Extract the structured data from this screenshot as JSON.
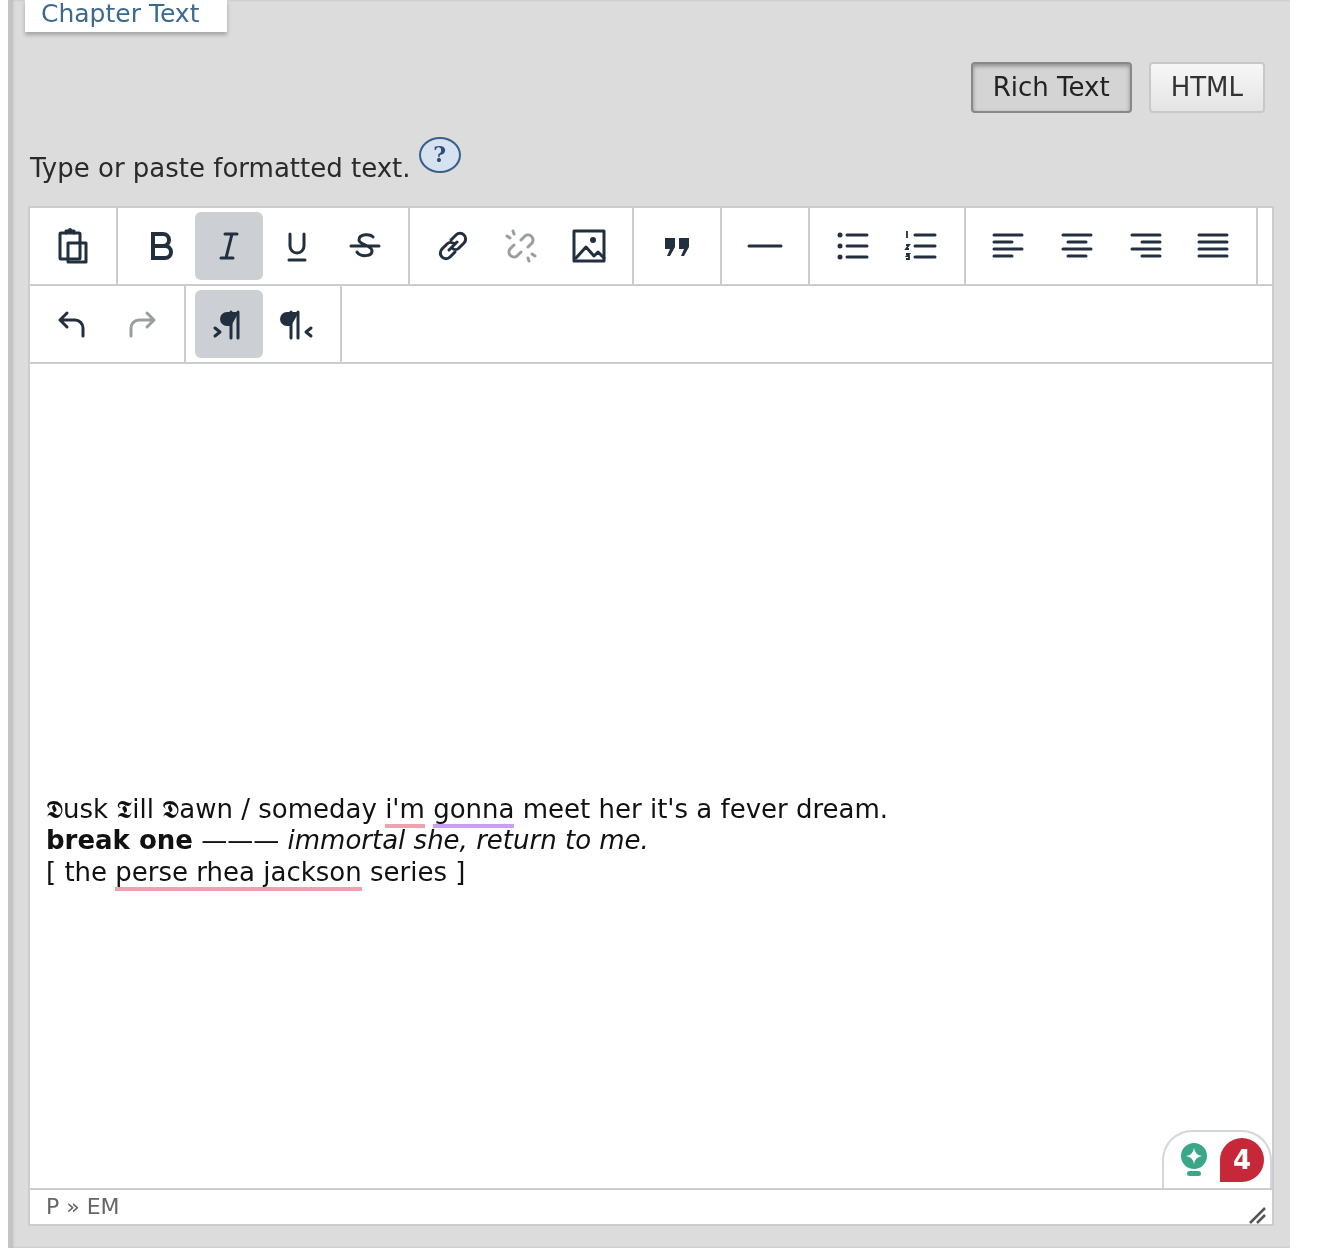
{
  "section_tab": {
    "label": "Chapter Text"
  },
  "mode_buttons": [
    {
      "label": "Rich Text",
      "selected": true
    },
    {
      "label": "HTML",
      "selected": false
    }
  ],
  "hint": {
    "text": "Type or paste formatted text.",
    "help": "?"
  },
  "toolbar": {
    "rows": [
      [
        [
          {
            "kind": "paste",
            "active": false,
            "disabled": false
          }
        ],
        [
          {
            "kind": "bold",
            "active": false,
            "disabled": false
          },
          {
            "kind": "italic",
            "active": true,
            "disabled": false
          },
          {
            "kind": "underline",
            "active": false,
            "disabled": false
          },
          {
            "kind": "strikethrough",
            "active": false,
            "disabled": false
          }
        ],
        [
          {
            "kind": "link",
            "active": false,
            "disabled": false
          },
          {
            "kind": "unlink",
            "active": false,
            "disabled": true
          },
          {
            "kind": "image",
            "active": false,
            "disabled": false
          }
        ],
        [
          {
            "kind": "blockquote",
            "active": false,
            "disabled": false
          }
        ],
        [
          {
            "kind": "hr",
            "active": false,
            "disabled": false
          }
        ],
        [
          {
            "kind": "bullets",
            "active": false,
            "disabled": false
          },
          {
            "kind": "numbers",
            "active": false,
            "disabled": false
          }
        ],
        [
          {
            "kind": "align-left",
            "active": false,
            "disabled": false
          },
          {
            "kind": "align-center",
            "active": false,
            "disabled": false
          },
          {
            "kind": "align-right",
            "active": false,
            "disabled": false
          },
          {
            "kind": "justify",
            "active": false,
            "disabled": false
          }
        ]
      ],
      [
        [
          {
            "kind": "undo",
            "active": false,
            "disabled": false
          },
          {
            "kind": "redo",
            "active": false,
            "disabled": true
          }
        ],
        [
          {
            "kind": "ltr",
            "active": true,
            "disabled": false
          },
          {
            "kind": "rtl",
            "active": false,
            "disabled": false
          }
        ]
      ]
    ]
  },
  "content": {
    "lines": [
      [
        {
          "text": "𝕯usk 𝕿ill 𝕯awn / someday ",
          "kind": "text"
        },
        {
          "text": "i'm",
          "kind": "spelling"
        },
        {
          "text": "gonna",
          "kind": "clarity"
        },
        {
          "text": " meet her it's a fever dream.",
          "kind": "text"
        }
      ],
      [
        {
          "text": "**break one** ——— *immortal she, return to me.*",
          "kind": "text"
        }
      ],
      [
        {
          "text": "[ the ",
          "kind": "text"
        },
        {
          "text": "perse rhea jackson",
          "kind": "spelling"
        },
        {
          "text": " series ]",
          "kind": "text"
        }
      ]
    ]
  },
  "assistant": {
    "alert_count": "4"
  },
  "status_bar": {
    "path": "P » EM"
  }
}
